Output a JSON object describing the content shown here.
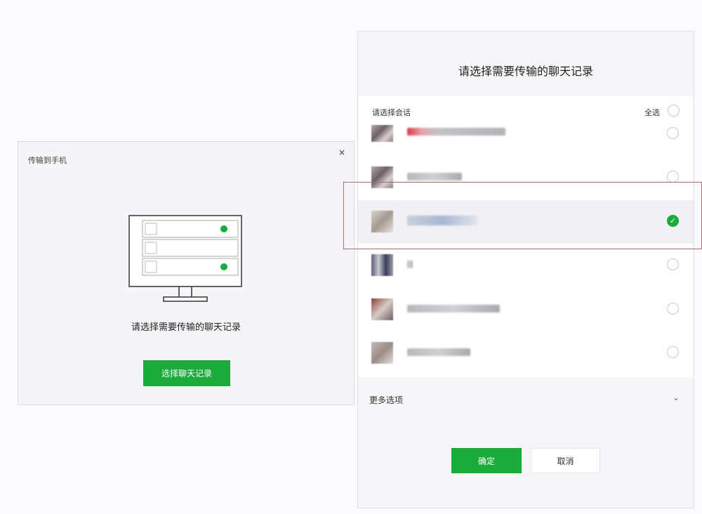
{
  "left_dialog": {
    "title": "传输到手机",
    "close_icon": "×",
    "description": "请选择需要传输的聊天记录",
    "select_button": "选择聊天记录"
  },
  "right_dialog": {
    "title": "请选择需要传输的聊天记录",
    "list_label": "请选择会话",
    "select_all": "全选",
    "conversations": [
      {
        "selected": false
      },
      {
        "selected": false
      },
      {
        "selected": true
      },
      {
        "selected": false
      },
      {
        "selected": false
      },
      {
        "selected": false
      }
    ],
    "more_options": "更多选项",
    "chevron": "⌄",
    "confirm_button": "确定",
    "cancel_button": "取消"
  },
  "colors": {
    "accent": "#1aab3b",
    "highlight_border": "#b46b6b"
  }
}
